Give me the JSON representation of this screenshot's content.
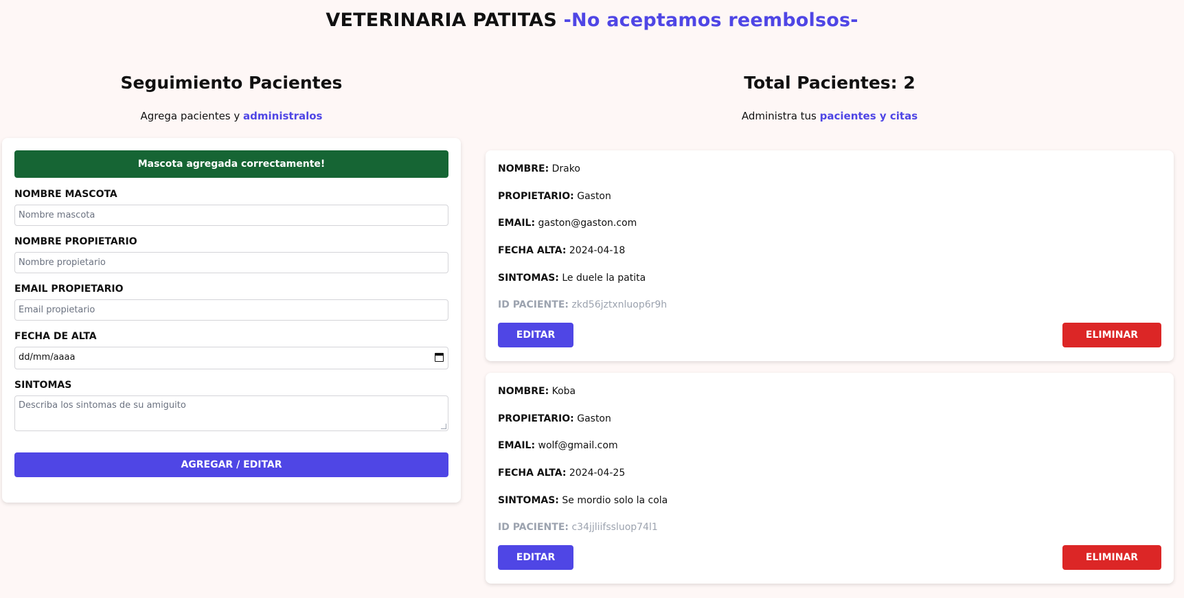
{
  "header": {
    "title": "VETERINARIA PATITAS",
    "tagline": "-No aceptamos reembolsos-"
  },
  "form_section": {
    "title": "Seguimiento Pacientes",
    "subtitle_prefix": "Agrega pacientes y ",
    "subtitle_accent": "administralos",
    "alert": "Mascota agregada correctamente!",
    "fields": {
      "pet_name": {
        "label": "NOMBRE MASCOTA",
        "placeholder": "Nombre mascota",
        "value": ""
      },
      "owner_name": {
        "label": "NOMBRE PROPIETARIO",
        "placeholder": "Nombre propietario",
        "value": ""
      },
      "owner_email": {
        "label": "EMAIL PROPIETARIO",
        "placeholder": "Email propietario",
        "value": ""
      },
      "date": {
        "label": "FECHA DE ALTA",
        "value": "dd/mm/aaaa"
      },
      "symptoms": {
        "label": "SINTOMAS",
        "placeholder": "Describa los sintomas de su amiguito",
        "value": ""
      }
    },
    "submit_label": "AGREGAR / EDITAR"
  },
  "list_section": {
    "title": "Total Pacientes: 2",
    "subtitle_prefix": "Administra tus ",
    "subtitle_accent": "pacientes y citas",
    "labels": {
      "name": "NOMBRE:",
      "owner": "PROPIETARIO:",
      "email": "EMAIL:",
      "date": "FECHA ALTA:",
      "symptoms": "SINTOMAS:",
      "id": "ID PACIENTE:"
    },
    "edit_label": "EDITAR",
    "delete_label": "ELIMINAR",
    "patients": [
      {
        "name": "Drako",
        "owner": "Gaston",
        "email": "gaston@gaston.com",
        "date": "2024-04-18",
        "symptoms": "Le duele la patita",
        "id": "zkd56jztxnluop6r9h"
      },
      {
        "name": "Koba",
        "owner": "Gaston",
        "email": "wolf@gmail.com",
        "date": "2024-04-25",
        "symptoms": "Se mordio solo la cola",
        "id": "c34jjliifssluop74l1"
      }
    ]
  },
  "colors": {
    "accent": "#4f46e5",
    "success": "#166534",
    "danger": "#dc2626",
    "background": "#fef7f6"
  }
}
